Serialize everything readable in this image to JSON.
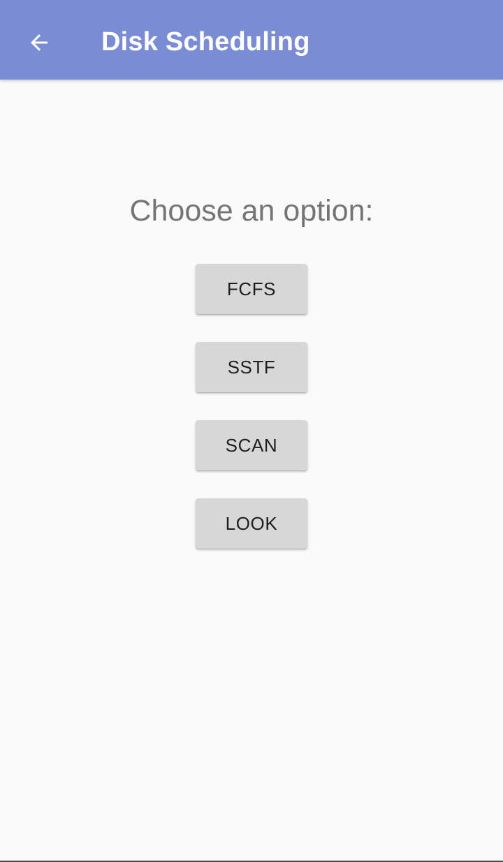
{
  "app_bar": {
    "title": "Disk Scheduling",
    "back_icon": "arrow-left-icon",
    "background_color": "#7a8cd4",
    "text_color": "#ffffff"
  },
  "main": {
    "prompt": "Choose an option:",
    "options": [
      {
        "label": "FCFS"
      },
      {
        "label": "SSTF"
      },
      {
        "label": "SCAN"
      },
      {
        "label": "LOOK"
      }
    ],
    "button_color": "#d7d7d7"
  }
}
